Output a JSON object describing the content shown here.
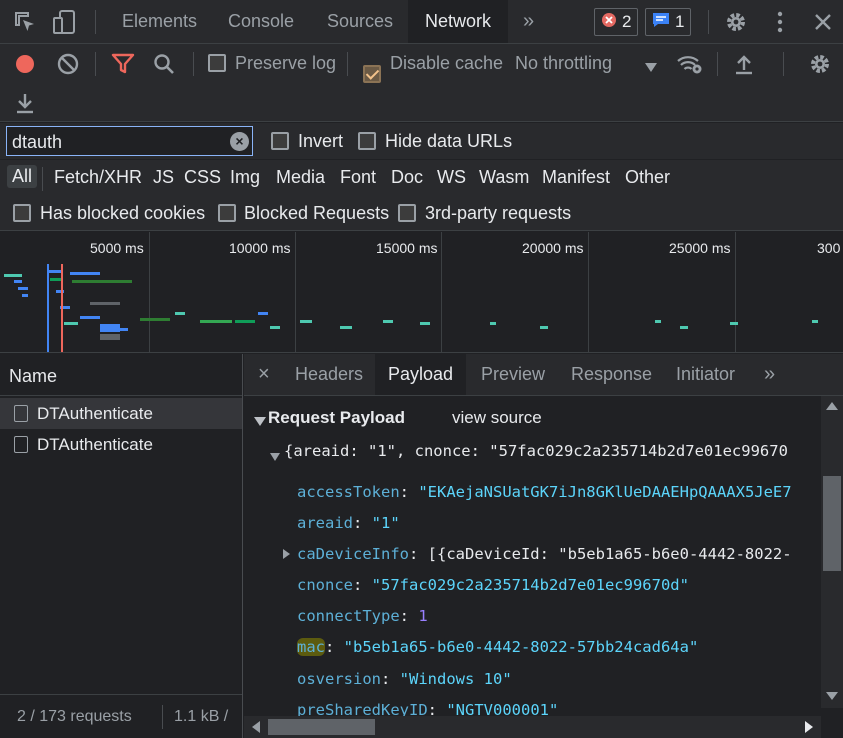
{
  "tabbar": {
    "tabs": [
      "Elements",
      "Console",
      "Sources",
      "Network"
    ],
    "active_tab": "Network",
    "errors_count": "2",
    "messages_count": "1"
  },
  "toolbar": {
    "preserve_log": "Preserve log",
    "disable_cache": "Disable cache",
    "throttling": "No throttling"
  },
  "filter": {
    "search_value": "dtauth",
    "invert": "Invert",
    "hide_data_urls": "Hide data URLs",
    "types": [
      "All",
      "Fetch/XHR",
      "JS",
      "CSS",
      "Img",
      "Media",
      "Font",
      "Doc",
      "WS",
      "Wasm",
      "Manifest",
      "Other"
    ],
    "has_blocked_cookies": "Has blocked cookies",
    "blocked_requests": "Blocked Requests",
    "third_party": "3rd-party requests"
  },
  "timeline": {
    "ticks": [
      "5000 ms",
      "10000 ms",
      "15000 ms",
      "20000 ms",
      "25000 ms",
      "300"
    ]
  },
  "requests": {
    "header": "Name",
    "items": [
      "DTAuthenticate",
      "DTAuthenticate"
    ],
    "summary": "2 / 173 requests",
    "transferred": "1.1 kB /"
  },
  "detail": {
    "tabs": [
      "Headers",
      "Payload",
      "Preview",
      "Response",
      "Initiator"
    ],
    "active_tab": "Payload",
    "section_title": "Request Payload",
    "view_source": "view source",
    "summary_line": "{areaid: \"1\", cnonce: \"57fac029c2a235714b2d7e01ec99670",
    "fields": [
      {
        "key": "accessToken",
        "value": "\"EKAejaNSUatGK7iJn8GKlUeDAAEHpQAAAX5JeE7",
        "type": "str"
      },
      {
        "key": "areaid",
        "value": "\"1\"",
        "type": "str"
      },
      {
        "key": "caDeviceInfo",
        "value": "[{caDeviceId: \"b5eb1a65-b6e0-4442-8022-",
        "type": "punc"
      },
      {
        "key": "cnonce",
        "value": "\"57fac029c2a235714b2d7e01ec99670d\"",
        "type": "str"
      },
      {
        "key": "connectType",
        "value": "1",
        "type": "num"
      },
      {
        "key": "mac",
        "value": "\"b5eb1a65-b6e0-4442-8022-57bb24cad64a\"",
        "type": "str"
      },
      {
        "key": "osversion",
        "value": "\"Windows 10\"",
        "type": "str"
      },
      {
        "key": "preSharedKeyID",
        "value": "\"NGTV000001\"",
        "type": "str"
      }
    ]
  },
  "colors": {
    "record": "#ee675c",
    "filter_active": "#ee675c",
    "accent": "#8ab4f8"
  }
}
